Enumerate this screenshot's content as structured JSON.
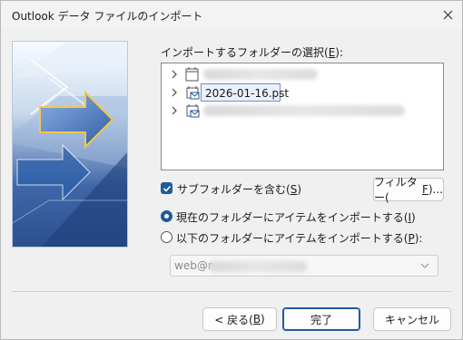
{
  "window": {
    "title": "Outlook データ ファイルのインポート",
    "close_icon": "close-icon"
  },
  "folder_select": {
    "label_prefix": "インポートするフォルダーの選択(",
    "label_key": "E",
    "label_suffix": "):",
    "tree": [
      {
        "name": "",
        "icon": "data-file-icon",
        "expanded": false
      },
      {
        "name": "2026-01-16.pst",
        "icon": "mail-folder-icon",
        "selected": true
      },
      {
        "name": "",
        "icon": "mail-folder-icon",
        "expanded": false
      }
    ]
  },
  "include_subfolders": {
    "checked": true,
    "label_prefix": "サブフォルダーを含む(",
    "label_key": "S",
    "label_suffix": ")"
  },
  "filter_button": {
    "label_prefix": "フィルター(",
    "label_key": "F",
    "label_suffix": ")..."
  },
  "import_target": {
    "option_current": {
      "label_prefix": "現在のフォルダーにアイテムをインポートする(",
      "label_key": "I",
      "label_suffix": ")",
      "selected": true
    },
    "option_below": {
      "label_prefix": "以下のフォルダーにアイテムをインポートする(",
      "label_key": "P",
      "label_suffix": "):",
      "selected": false
    },
    "target_folder_value": "web@r",
    "dropdown_disabled": true
  },
  "footer": {
    "back_prefix": "< 戻る(",
    "back_key": "B",
    "back_suffix": ")",
    "finish_label": "完了",
    "cancel_label": "キャンセル"
  },
  "colors": {
    "accent": "#1f5a9c",
    "background": "#f0f0f0"
  }
}
